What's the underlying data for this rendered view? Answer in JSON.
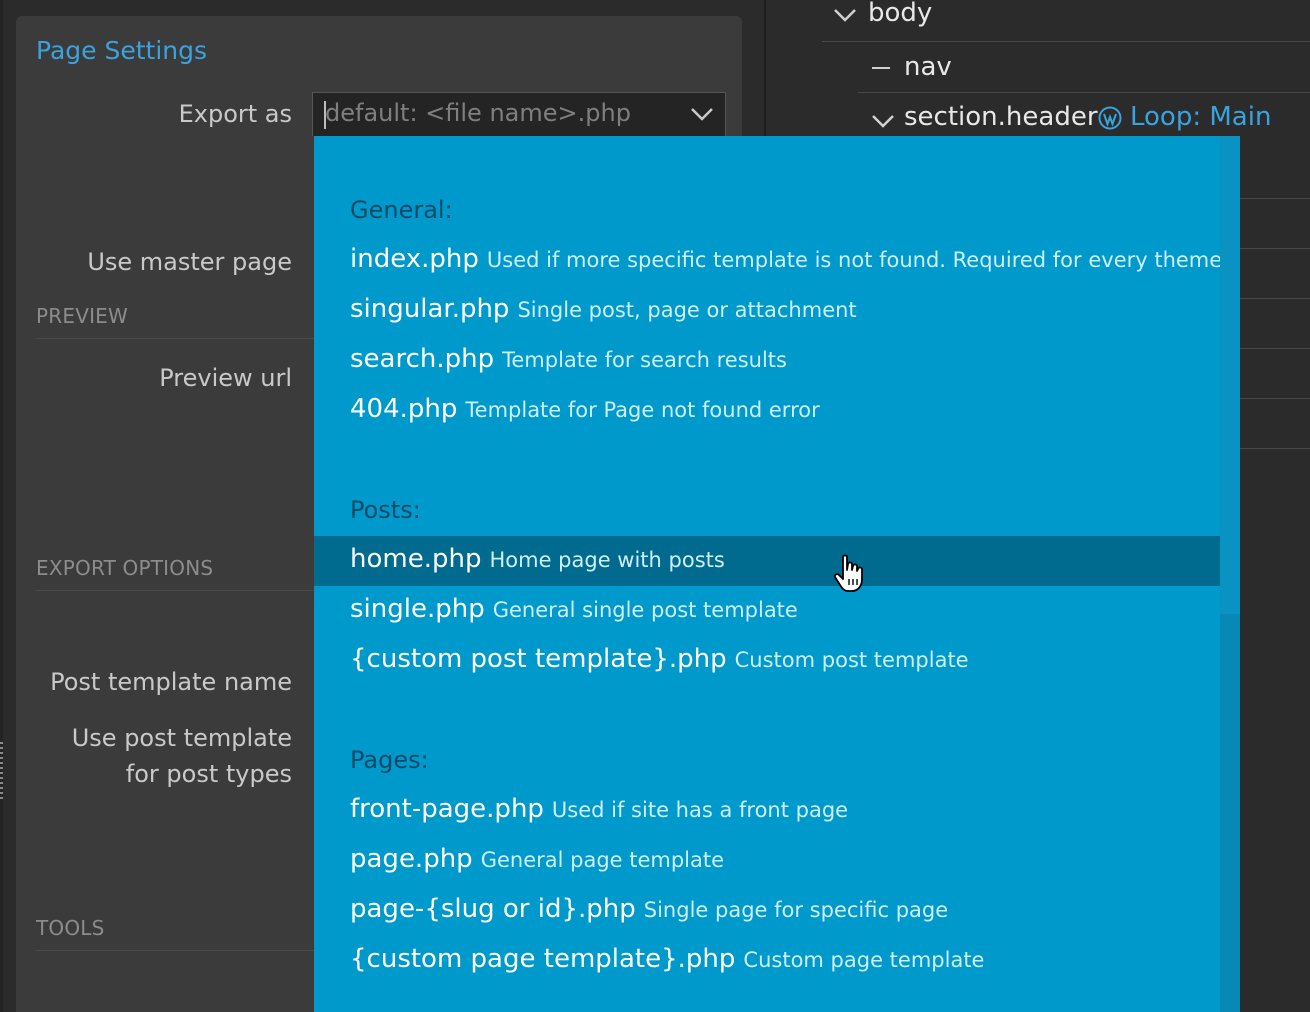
{
  "page_settings": {
    "title": "Page Settings",
    "export_as_label": "Export as",
    "export_as_placeholder": "default: <file name>.php",
    "use_master_page_label": "Use master page",
    "preview_head": "PREVIEW",
    "preview_url_label": "Preview url",
    "export_options_head": "EXPORT OPTIONS",
    "post_template_name_label": "Post template name",
    "use_post_template_label_1": "Use post template",
    "use_post_template_label_2": "for post types",
    "tools_head": "TOOLS"
  },
  "tree": {
    "body": "body",
    "nav": "nav",
    "section_header": "section.header",
    "loop": "Loop: Main"
  },
  "dropdown": {
    "groups": [
      {
        "heading": "General:",
        "options": [
          {
            "file": "index.php",
            "desc": "Used if more specific template is not found. Required for every theme."
          },
          {
            "file": "singular.php",
            "desc": "Single post, page or attachment"
          },
          {
            "file": "search.php",
            "desc": "Template for search results"
          },
          {
            "file": "404.php",
            "desc": "Template for Page not found error"
          }
        ]
      },
      {
        "heading": "Posts:",
        "options": [
          {
            "file": "home.php",
            "desc": "Home page with posts"
          },
          {
            "file": "single.php",
            "desc": "General single post template"
          },
          {
            "file": "{custom post template}.php",
            "desc": "Custom post template"
          }
        ]
      },
      {
        "heading": "Pages:",
        "options": [
          {
            "file": "front-page.php",
            "desc": "Used if site has a front page"
          },
          {
            "file": "page.php",
            "desc": "General page template"
          },
          {
            "file": "page-{slug or id}.php",
            "desc": "Single page for specific page"
          },
          {
            "file": "{custom page template}.php",
            "desc": "Custom page template"
          }
        ]
      }
    ]
  },
  "colors": {
    "accent": "#3aa3dd",
    "dropdown_bg": "#0099cc",
    "dropdown_active": "#006b8f",
    "panel_bg": "#3b3b3b"
  }
}
